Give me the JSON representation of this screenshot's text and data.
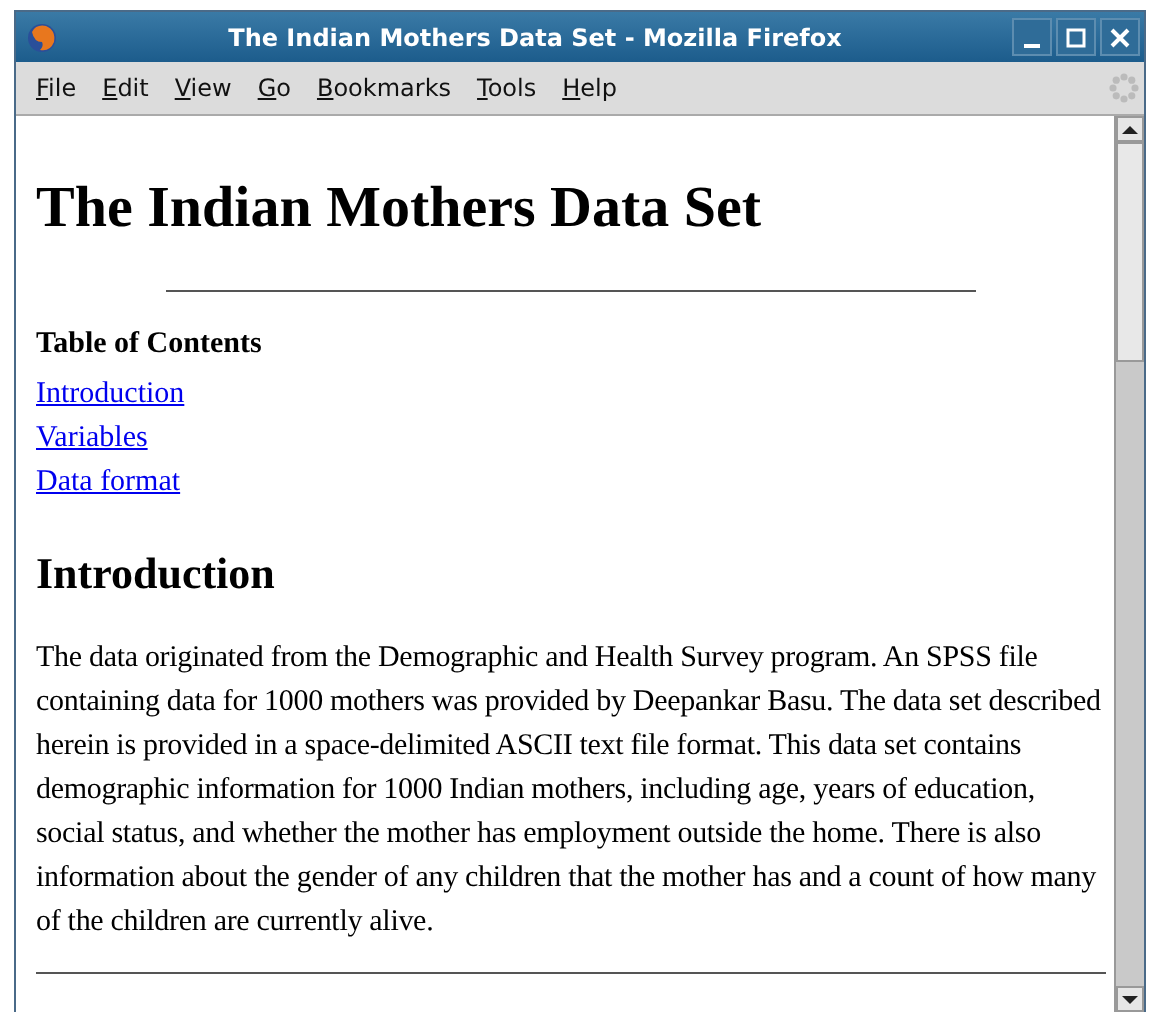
{
  "window": {
    "title": "The Indian Mothers Data Set - Mozilla Firefox"
  },
  "menu": [
    "File",
    "Edit",
    "View",
    "Go",
    "Bookmarks",
    "Tools",
    "Help"
  ],
  "page": {
    "heading": "The Indian Mothers Data Set",
    "toc_title": "Table of Contents",
    "toc_links": [
      "Introduction",
      "Variables",
      "Data format"
    ],
    "section_heading": "Introduction",
    "paragraph": "The data originated from the Demographic and Health Survey program. An SPSS file containing data for 1000 mothers was provided by Deepankar Basu. The data set described herein is provided in a space-delimited ASCII text file format. This data set contains demographic information for 1000 Indian mothers, including age, years of education, social status, and whether the mother has employment outside the home. There is also information about the gender of any children that the mother has and a count of how many of the children are currently alive."
  }
}
